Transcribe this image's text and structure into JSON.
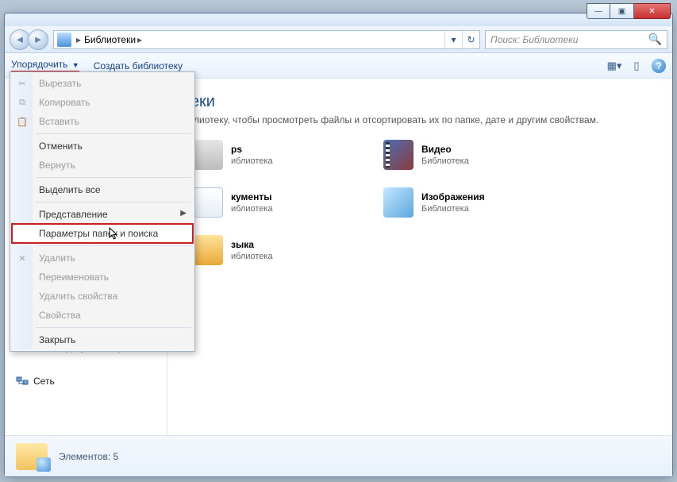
{
  "title_buttons": {
    "min": "—",
    "max": "▣",
    "close": "✕"
  },
  "address": {
    "root": "Библиотеки",
    "sep": "▸"
  },
  "search": {
    "placeholder": "Поиск: Библиотеки"
  },
  "toolbar": {
    "organize": "Упорядочить",
    "new_library": "Создать библиотеку"
  },
  "sidebar": {
    "drive": "Мои документы (D:",
    "network": "Сеть"
  },
  "page": {
    "title": "теки",
    "subtitle": "иблиотеку, чтобы просмотреть файлы и отсортировать их по папке, дате и другим свойствам.",
    "libtype": "иблиотека",
    "libtype_full": "Библиотека"
  },
  "libs": {
    "apps": "ps",
    "video": "Видео",
    "docs": "кументы",
    "images": "Изображения",
    "music": "зыка"
  },
  "status": {
    "label": "Элементов: 5"
  },
  "menu": {
    "cut": "Вырезать",
    "copy": "Копировать",
    "paste": "Вставить",
    "undo": "Отменить",
    "redo": "Вернуть",
    "select_all": "Выделить все",
    "view": "Представление",
    "folder_opts": "Параметры папок и поиска",
    "delete": "Удалить",
    "rename": "Переименовать",
    "remove_props": "Удалить свойства",
    "properties": "Свойства",
    "close": "Закрыть"
  }
}
